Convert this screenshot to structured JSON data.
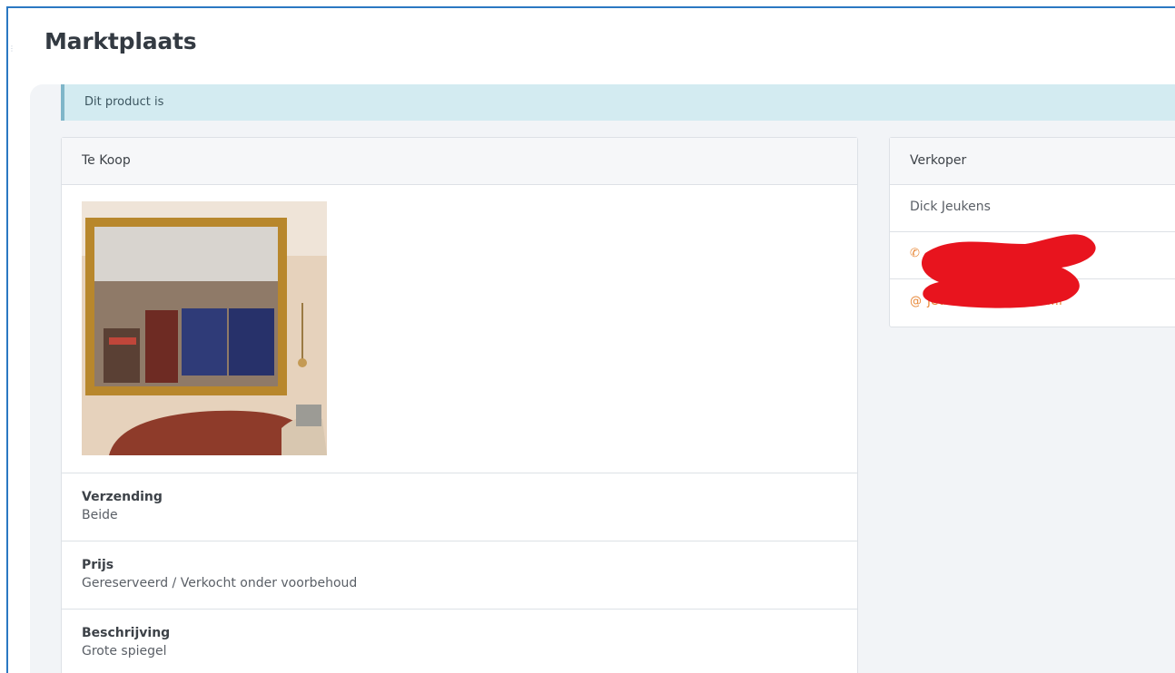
{
  "header": {
    "title": "Marktplaats"
  },
  "alert": {
    "text": "Dit product is"
  },
  "listing": {
    "panel_title": "Te Koop",
    "fields": [
      {
        "label": "Verzending",
        "value": "Beide"
      },
      {
        "label": "Prijs",
        "value": "Gereserveerd / Verkocht onder voorbehoud"
      },
      {
        "label": "Beschrijving",
        "value": "Grote spiegel"
      }
    ]
  },
  "seller": {
    "panel_title": "Verkoper",
    "name": "Dick Jeukens",
    "phone": "",
    "email": "jeukens@jeukensw...l",
    "phone_icon": "phone-icon",
    "email_icon": "at-icon"
  },
  "colors": {
    "accent": "#e8893a",
    "alert_bg": "#d3ebf1",
    "frame": "#2b78c2",
    "redaction": "#e8141e"
  }
}
